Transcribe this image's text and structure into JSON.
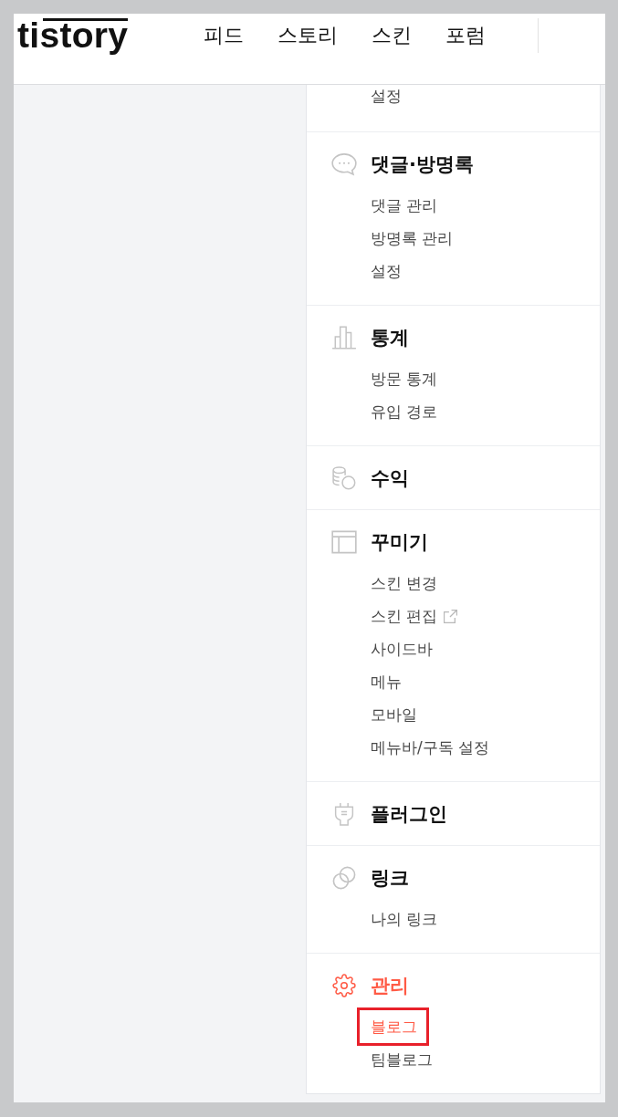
{
  "header": {
    "logo": "tistory",
    "nav": [
      "피드",
      "스토리",
      "스킨",
      "포럼"
    ]
  },
  "sidebar": {
    "partial_section": {
      "items": [
        {
          "label": "설정",
          "selected": false
        }
      ]
    },
    "sections": [
      {
        "kind": "comments",
        "title": "댓글·방명록",
        "selected": false,
        "items": [
          {
            "label": "댓글 관리",
            "selected": false
          },
          {
            "label": "방명록 관리",
            "selected": false
          },
          {
            "label": "설정",
            "selected": false
          }
        ]
      },
      {
        "kind": "stats",
        "title": "통계",
        "selected": false,
        "items": [
          {
            "label": "방문 통계",
            "selected": false
          },
          {
            "label": "유입 경로",
            "selected": false
          }
        ]
      },
      {
        "kind": "revenue",
        "title": "수익",
        "selected": false
      },
      {
        "kind": "design",
        "title": "꾸미기",
        "selected": false,
        "items": [
          {
            "label": "스킨 변경",
            "selected": false,
            "external": false
          },
          {
            "label": "스킨 편집",
            "selected": false,
            "external": true
          },
          {
            "label": "사이드바",
            "selected": false,
            "external": false
          },
          {
            "label": "메뉴",
            "selected": false,
            "external": false
          },
          {
            "label": "모바일",
            "selected": false,
            "external": false
          },
          {
            "label": "메뉴바/구독 설정",
            "selected": false,
            "external": false
          }
        ]
      },
      {
        "kind": "plugin",
        "title": "플러그인",
        "selected": false
      },
      {
        "kind": "link",
        "title": "링크",
        "selected": false,
        "items": [
          {
            "label": "나의 링크",
            "selected": false
          }
        ]
      },
      {
        "kind": "manage",
        "title": "관리",
        "selected": true,
        "items": [
          {
            "label": "블로그",
            "selected": true,
            "highlighted": true
          },
          {
            "label": "팀블로그",
            "selected": false,
            "highlighted": false
          }
        ]
      }
    ]
  }
}
